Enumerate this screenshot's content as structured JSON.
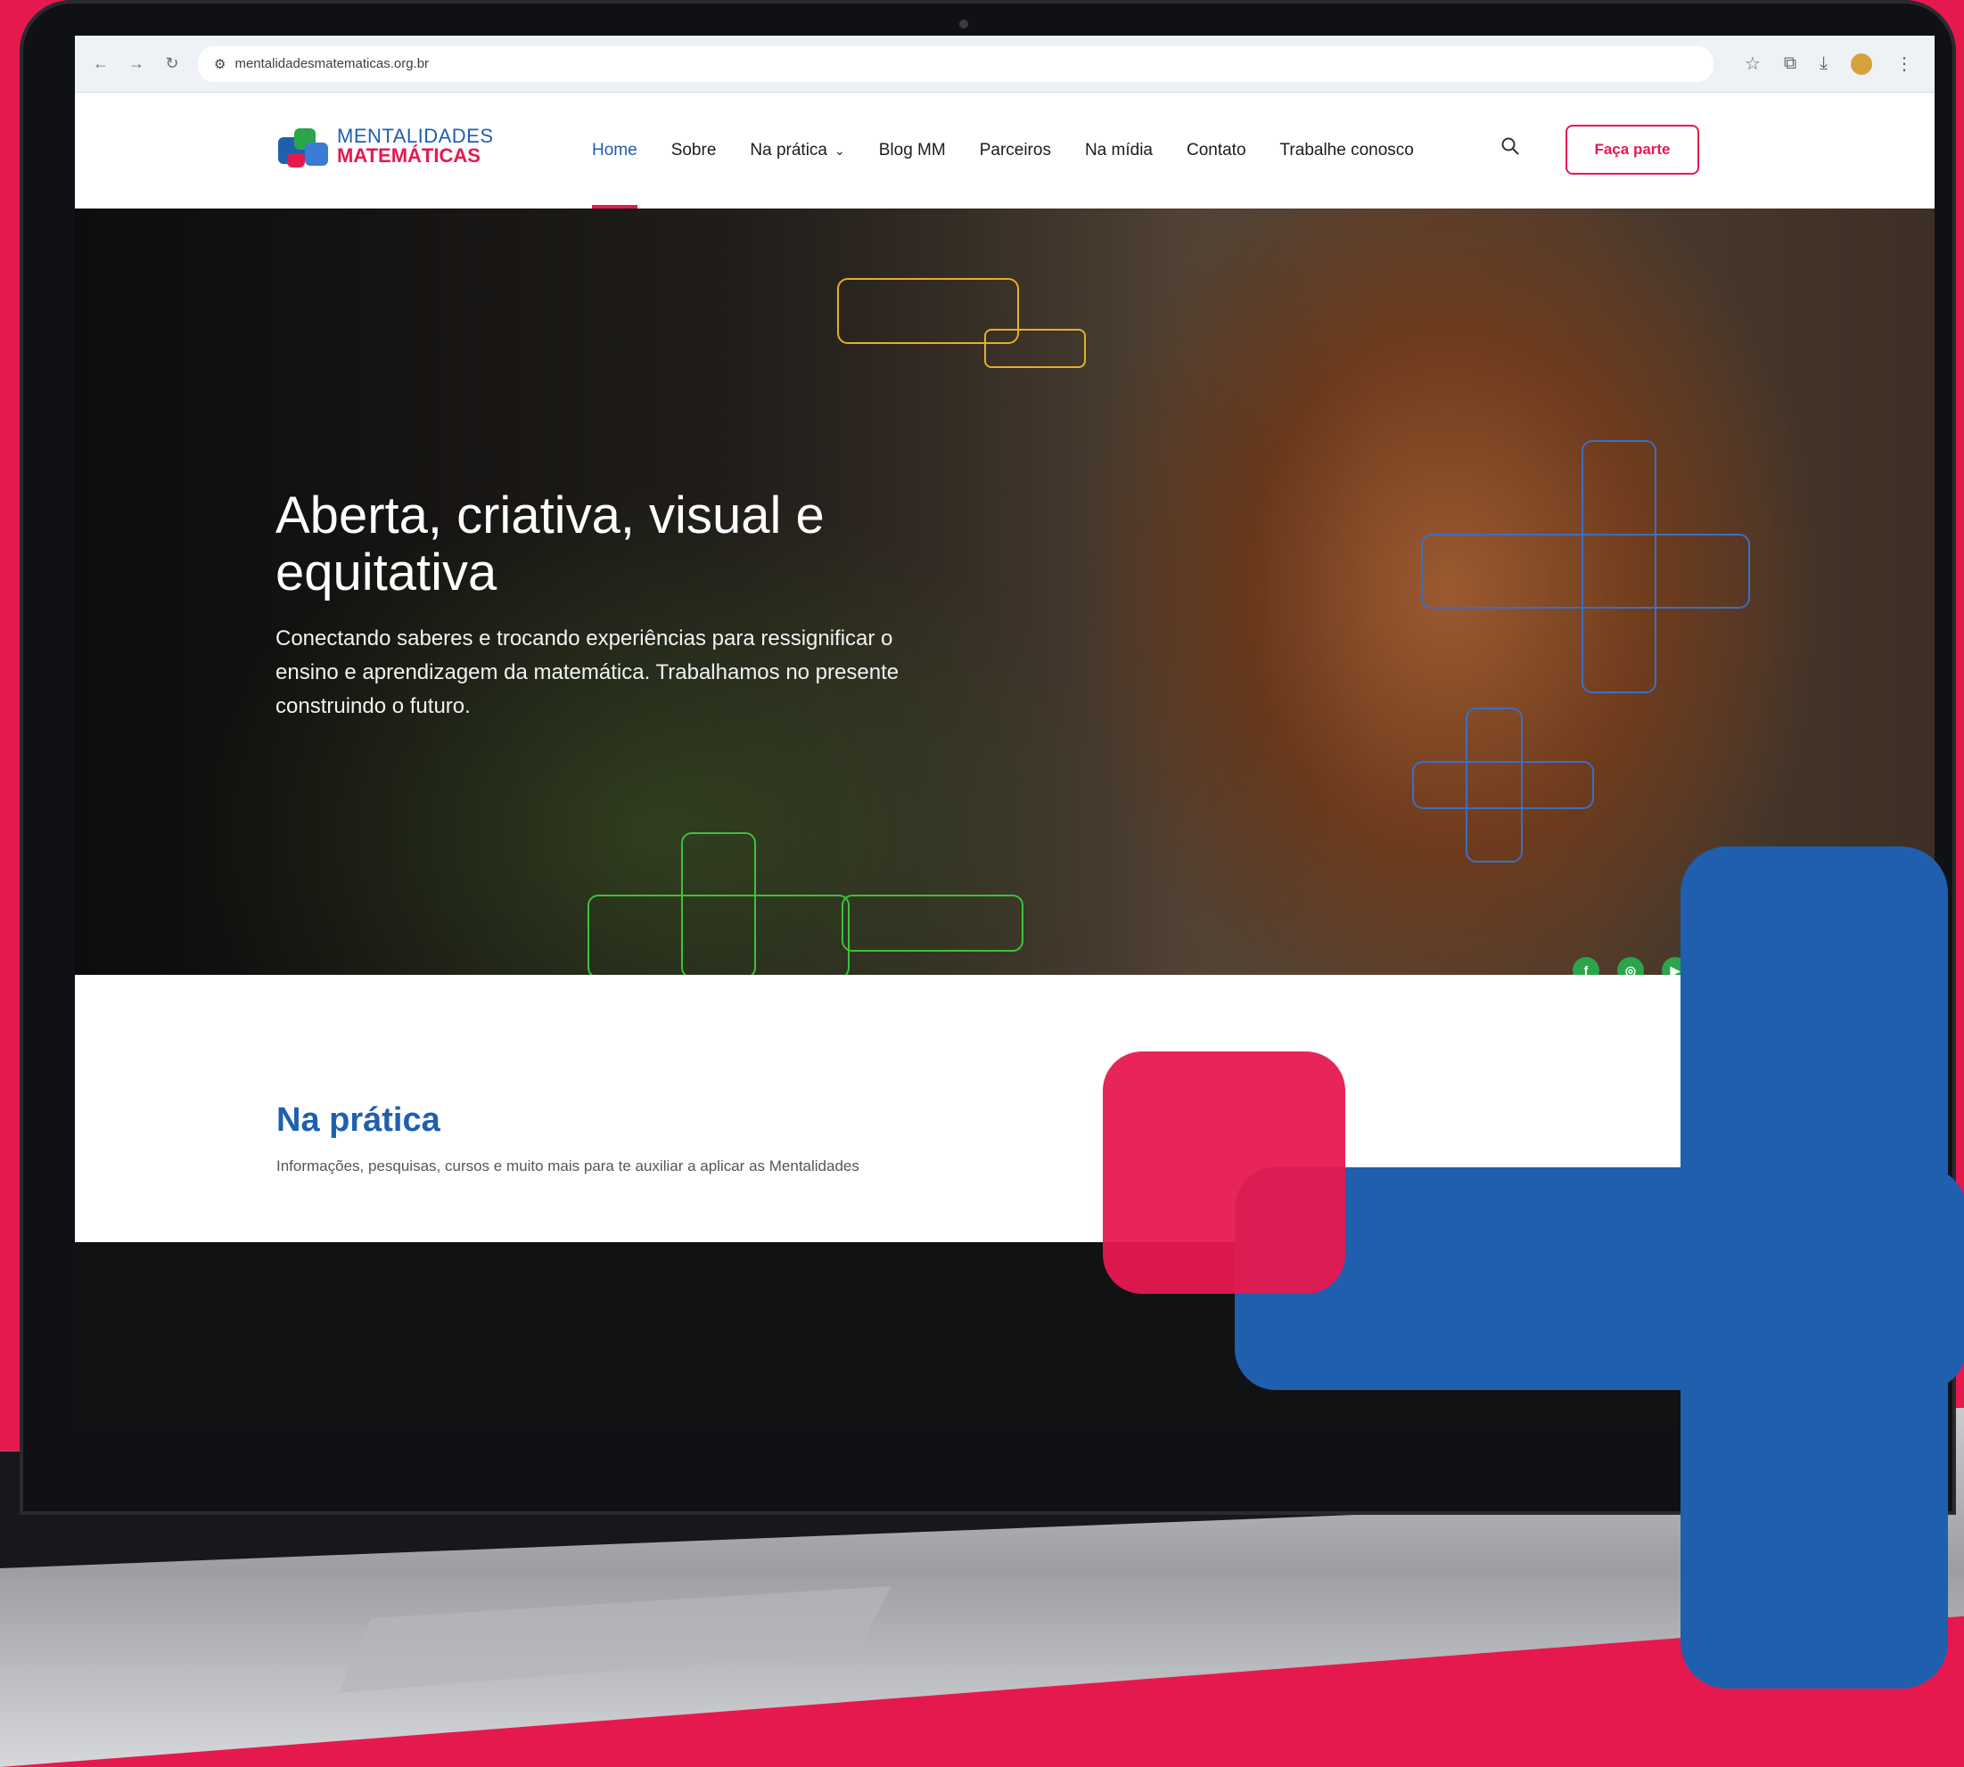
{
  "browser": {
    "url": "mentalidadesmatematicas.org.br"
  },
  "logo": {
    "line1": "MENTALIDADES",
    "line2": "MATEMÁTICAS"
  },
  "nav": {
    "items": [
      "Home",
      "Sobre",
      "Na prática",
      "Blog MM",
      "Parceiros",
      "Na mídia",
      "Contato",
      "Trabalhe conosco"
    ],
    "active": "Home",
    "dropdown_item": "Na prática",
    "cta_label": "Faça parte"
  },
  "hero": {
    "title": "Aberta, criativa, visual e equitativa",
    "subtitle": "Conectando saberes e trocando experiências para ressignificar o ensino e aprendizagem da matemática. Trabalhamos no presente construindo o futuro."
  },
  "section": {
    "title": "Na prática",
    "subtitle": "Informações, pesquisas, cursos e muito mais para te auxiliar a aplicar as Mentalidades"
  },
  "colors": {
    "brand_red": "#e6194f",
    "brand_blue": "#1f5fae",
    "social_green": "#2aa54a"
  },
  "icons": {
    "social": [
      "facebook-icon",
      "instagram-icon",
      "youtube-icon"
    ]
  }
}
